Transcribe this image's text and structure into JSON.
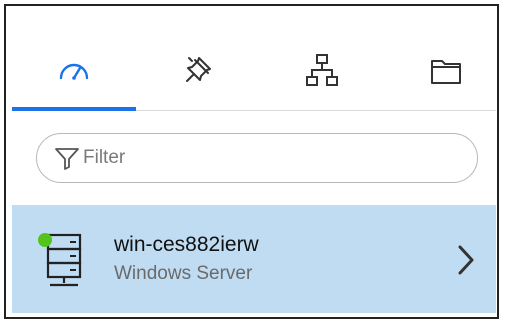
{
  "tabs": [
    {
      "icon": "speedometer-icon",
      "active": true
    },
    {
      "icon": "pin-icon",
      "active": false
    },
    {
      "icon": "network-hierarchy-icon",
      "active": false
    },
    {
      "icon": "folder-icon",
      "active": false
    }
  ],
  "filter": {
    "placeholder": "Filter",
    "value": ""
  },
  "list": [
    {
      "title": "win-ces882ierw",
      "subtitle": "Windows Server",
      "status_color": "#52c41a",
      "icon": "server-icon"
    }
  ],
  "colors": {
    "accent": "#1a73e8",
    "selected_row": "#bfdcf3",
    "status_online": "#52c41a"
  }
}
